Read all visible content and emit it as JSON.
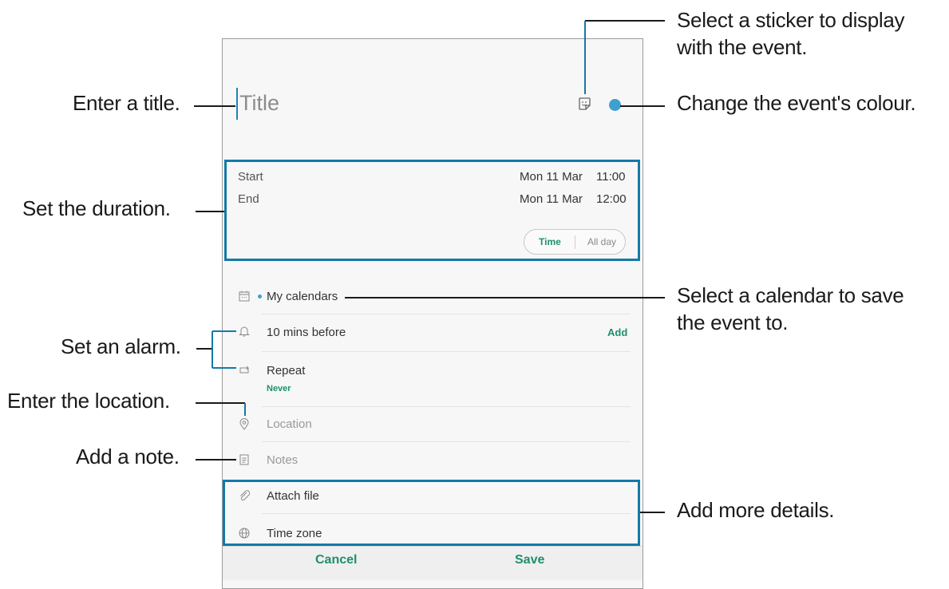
{
  "event_form": {
    "title_placeholder": "Title",
    "start_label": "Start",
    "start_date": "Mon 11 Mar",
    "start_time": "11:00",
    "end_label": "End",
    "end_date": "Mon 11 Mar",
    "end_time": "12:00",
    "toggle_time": "Time",
    "toggle_all_day": "All day",
    "calendar": "My calendars",
    "alarm": "10 mins before",
    "alarm_add": "Add",
    "repeat_label": "Repeat",
    "repeat_value": "Never",
    "location_placeholder": "Location",
    "notes_placeholder": "Notes",
    "attach_file": "Attach file",
    "time_zone": "Time zone",
    "cancel": "Cancel",
    "save": "Save",
    "event_color": "#3ea0d0",
    "accent_color": "#1f8f6e"
  },
  "annotations": {
    "enter_title": "Enter a title.",
    "set_duration": "Set the duration.",
    "set_alarm": "Set an alarm.",
    "enter_location": "Enter the location.",
    "add_note": "Add a note.",
    "sticker_line1": "Select a sticker to display",
    "sticker_line2": "with the event.",
    "change_colour": "Change the event's colour.",
    "calendar_line1": "Select a calendar to save",
    "calendar_line2": "the event to.",
    "more_details": "Add more details."
  },
  "icons": [
    "sticker-icon",
    "calendar-icon",
    "bell-icon",
    "repeat-icon",
    "location-pin-icon",
    "notes-icon",
    "paperclip-icon",
    "globe-icon"
  ]
}
